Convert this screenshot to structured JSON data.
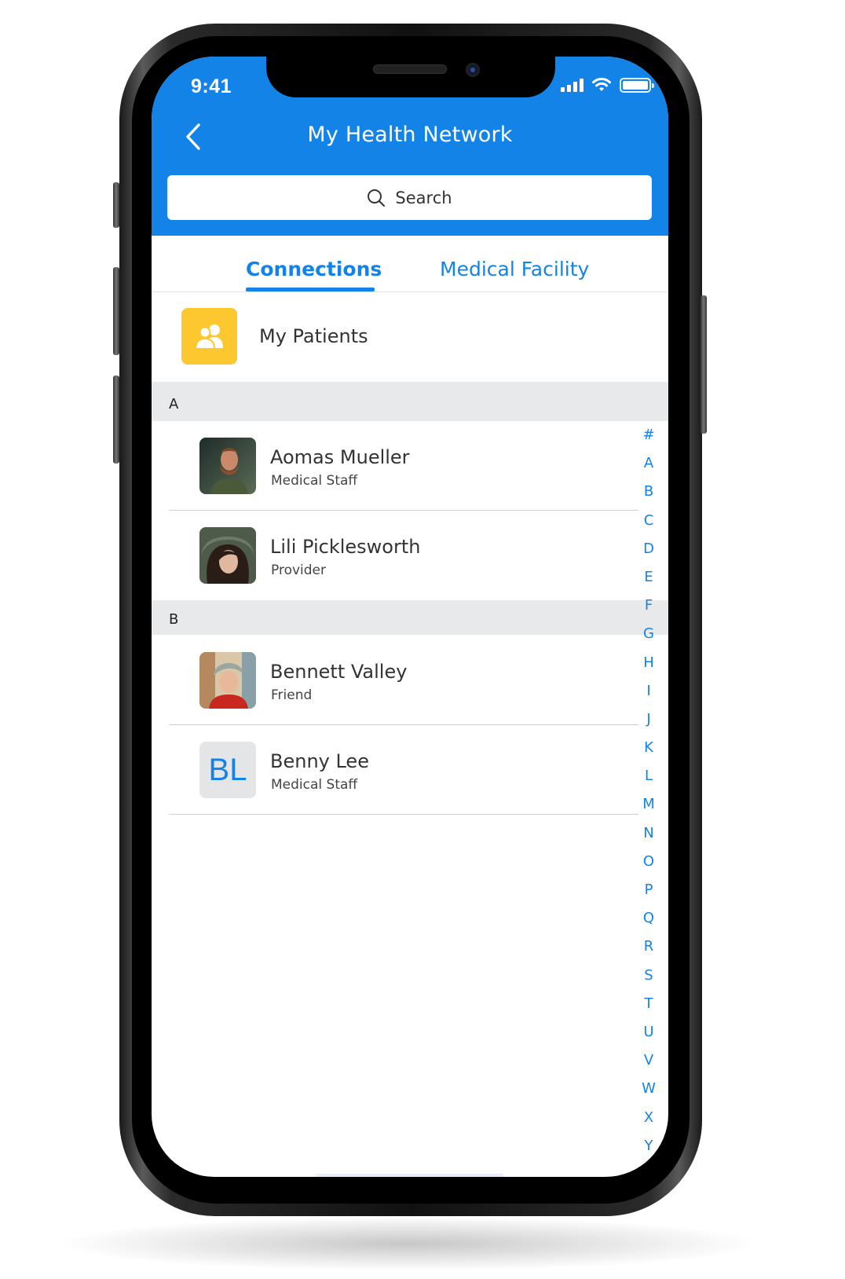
{
  "status_bar": {
    "time": "9:41"
  },
  "header": {
    "title": "My Health Network",
    "back_icon": "chevron-left-icon"
  },
  "search": {
    "placeholder": "Search",
    "icon": "search-icon"
  },
  "tabs": [
    {
      "label": "Connections",
      "active": true
    },
    {
      "label": "Medical Facility",
      "active": false
    }
  ],
  "my_patients": {
    "label": "My Patients",
    "icon": "users-icon",
    "icon_color": "#fdc72f"
  },
  "sections": [
    {
      "letter": "A",
      "contacts": [
        {
          "name": "Aomas Mueller",
          "role": "Medical Staff",
          "avatar": "photo"
        },
        {
          "name": "Lili Picklesworth",
          "role": "Provider",
          "avatar": "photo"
        }
      ]
    },
    {
      "letter": "B",
      "contacts": [
        {
          "name": "Bennett Valley",
          "role": "Friend",
          "avatar": "photo"
        },
        {
          "name": "Benny Lee",
          "role": "Medical Staff",
          "avatar": "initials",
          "initials": "BL"
        }
      ]
    }
  ],
  "index_letters": [
    "#",
    "A",
    "B",
    "C",
    "D",
    "E",
    "F",
    "G",
    "H",
    "I",
    "J",
    "K",
    "L",
    "M",
    "N",
    "O",
    "P",
    "Q",
    "R",
    "S",
    "T",
    "U",
    "V",
    "W",
    "X",
    "Y"
  ],
  "colors": {
    "accent": "#1383e8",
    "section_bg": "#e8e9eb",
    "patients_icon_bg": "#fdc72f"
  }
}
